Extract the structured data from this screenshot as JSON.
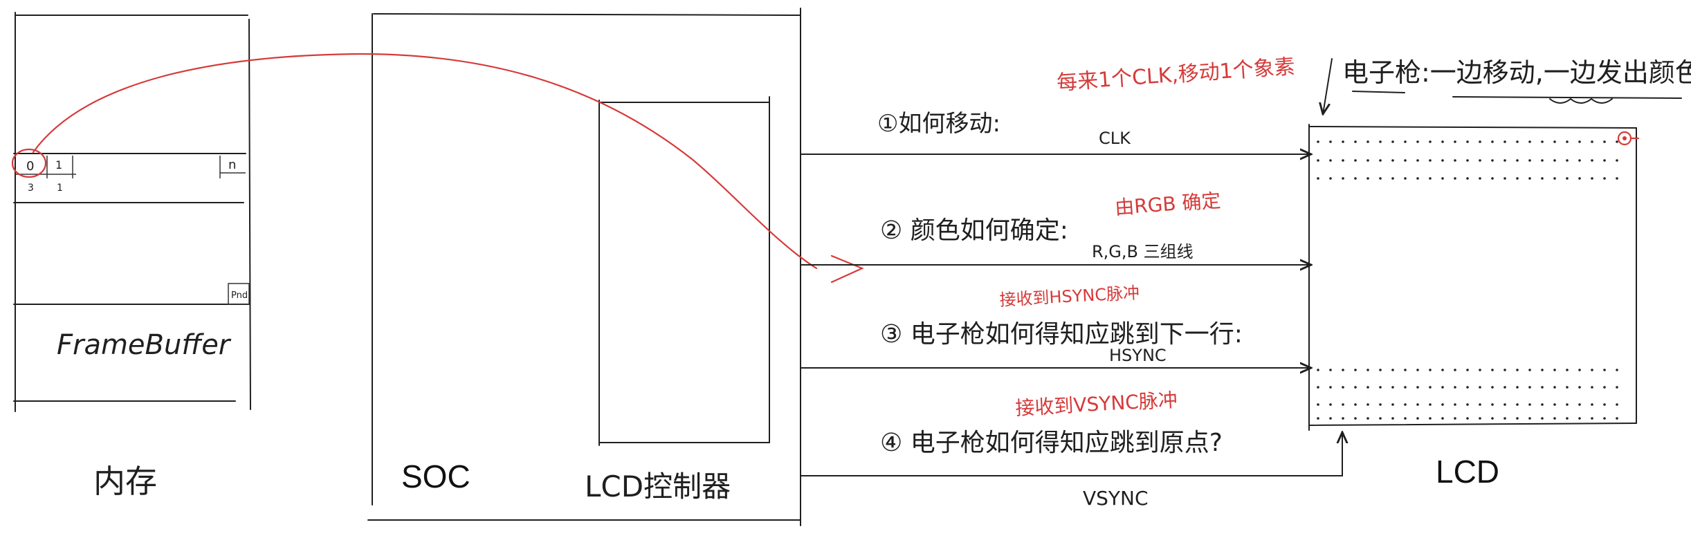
{
  "memory": {
    "cell_labels": [
      "0",
      "1",
      "n"
    ],
    "cell_sublabels": [
      "3",
      "1"
    ],
    "end_label": "Pnd",
    "framebuffer_label": "FrameBuffer",
    "memory_label": "内存"
  },
  "soc": {
    "label": "SOC",
    "controller_label": "LCD控制器"
  },
  "questions": [
    {
      "text": "①如何移动:",
      "signal": "CLK",
      "note": "每来1个CLK,移动1个象素"
    },
    {
      "text": "② 颜色如何确定:",
      "signal": "R,G,B 三组线",
      "note": "由RGB 确定"
    },
    {
      "text": "③ 电子枪如何得知应跳到下一行:",
      "signal": "HSYNC",
      "note": "接收到HSYNC脉冲"
    },
    {
      "text": "④ 电子枪如何得知应跳到原点?",
      "signal": "VSYNC",
      "note": "接收到VSYNC脉冲"
    }
  ],
  "lcd": {
    "label": "LCD",
    "gun_note": "电子枪:一边移动,一边发出颜色"
  },
  "colors": {
    "ink": "#1f1f1f",
    "annotation_red": "#d63a3a",
    "background": "#ffffff"
  }
}
